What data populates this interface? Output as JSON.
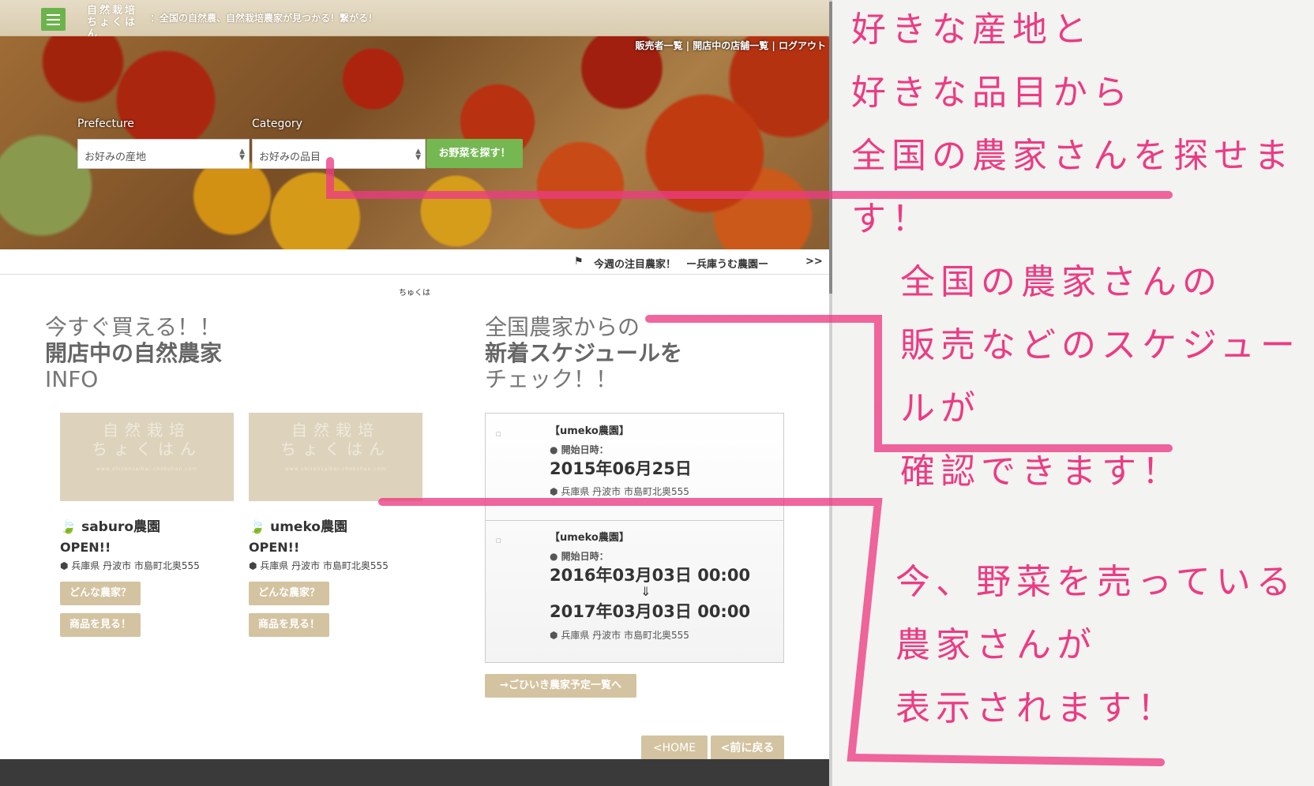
{
  "header": {
    "logo_line1": "自然栽培",
    "logo_line2": "ちょくはん",
    "tagline": "：全国の自然農、自然栽培農家が見つかる！繋がる！"
  },
  "hero": {
    "nav_links": "販売者一覧 | 開店中の店舗一覧 | ログアウト",
    "prefecture_label": "Prefecture",
    "prefecture_value": "お好みの産地",
    "category_label": "Category",
    "category_value": "お好みの品目",
    "search_button": "お野菜を探す！"
  },
  "ticker": {
    "flag_icon": "⚑",
    "text": "今週の注目農家！　ー兵庫うむ農園ー",
    "next": ">>"
  },
  "mini_logo": "ちゅくは",
  "left_heading": {
    "line1": "今すぐ買える！！",
    "line2": "開店中の自然農家",
    "line3": "INFO"
  },
  "right_heading": {
    "line1": "全国農家からの",
    "line2": "新着スケジュールを",
    "line3": "チェック！！"
  },
  "thumb": {
    "line1": "自然栽培",
    "line2": "ちょくはん",
    "url": "www.shizensaibai-chokuhan.com"
  },
  "farms": [
    {
      "name": "saburo農園",
      "status": "OPEN!!",
      "address": "兵庫県 丹波市 市島町北奥555",
      "about_button": "どんな農家？",
      "goods_button": "商品を見る！"
    },
    {
      "name": "umeko農園",
      "status": "OPEN!!",
      "address": "兵庫県 丹波市 市島町北奥555",
      "about_button": "どんな農家？",
      "goods_button": "商品を見る！"
    }
  ],
  "schedule": [
    {
      "farm": "【umeko農園】",
      "label": "開始日時：",
      "date": "2015年06月25日",
      "location": "兵庫県 丹波市 市島町北奥555"
    },
    {
      "farm": "【umeko農園】",
      "label": "開始日時：",
      "date": "2016年03月03日 00:00",
      "arrow": "⇓",
      "end_date": "2017年03月03日 00:00",
      "location": "兵庫県 丹波市 市島町北奥555"
    }
  ],
  "more_button": "→ごひいき農家予定一覧へ",
  "home_button": "<HOME",
  "back_button": "<前に戻る",
  "annotations": [
    {
      "lines": [
        "好きな産地と",
        "好きな品目から",
        "全国の農家さんを探せます！"
      ]
    },
    {
      "lines": [
        "全国の農家さんの",
        "販売などのスケジュールが",
        "確認できます！"
      ]
    },
    {
      "lines": [
        "今、野菜を売っている",
        "農家さんが",
        "表示されます！"
      ]
    }
  ],
  "colors": {
    "accent_green": "#75b852",
    "tan": "#d3c3a0",
    "annotation_pink": "#ec3b83"
  }
}
